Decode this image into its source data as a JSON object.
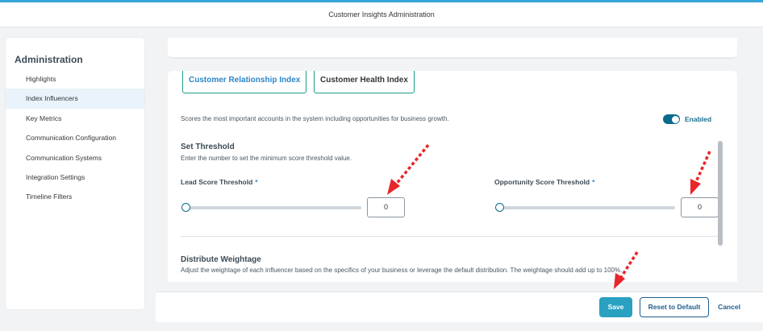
{
  "header": {
    "title": "Customer Insights Administration"
  },
  "sidebar": {
    "heading": "Administration",
    "items": [
      {
        "label": "Highlights"
      },
      {
        "label": "Index Influencers"
      },
      {
        "label": "Key Metrics"
      },
      {
        "label": "Communication Configuration"
      },
      {
        "label": "Communication Systems"
      },
      {
        "label": "Integration Settings"
      },
      {
        "label": "Timeline Filters"
      }
    ],
    "active_item": "Index Influencers"
  },
  "tabs": [
    {
      "label": "Customer Relationship Index",
      "selected": true
    },
    {
      "label": "Customer Health Index",
      "selected": false
    }
  ],
  "index": {
    "description": "Scores the most important accounts in the system including opportunities for business growth.",
    "toggle_label": "Enabled",
    "enabled": true
  },
  "threshold": {
    "title": "Set Threshold",
    "subtitle": "Enter the number to set the minimum score threshold value.",
    "lead": {
      "label": "Lead Score Threshold",
      "required_marker": "*",
      "value": "0",
      "slider_fraction": 0
    },
    "opportunity": {
      "label": "Opportunity Score Threshold",
      "required_marker": "*",
      "value": "0",
      "slider_fraction": 0
    }
  },
  "weightage": {
    "title": "Distribute Weightage",
    "subtitle": "Adjust the weightage of each influencer based on the specifics of your business or leverage the default distribution. The weightage should add up to 100%."
  },
  "footer": {
    "save_label": "Save",
    "reset_label": "Reset to Default",
    "cancel_label": "Cancel"
  },
  "colors": {
    "accent": "#2aa1c0",
    "tab_border": "#1f9d8b",
    "toggle_on": "#0a6a8c",
    "annotation_arrow": "#e8262a"
  },
  "icons": [
    "mouse-cursor-icon",
    "toggle-switch"
  ]
}
